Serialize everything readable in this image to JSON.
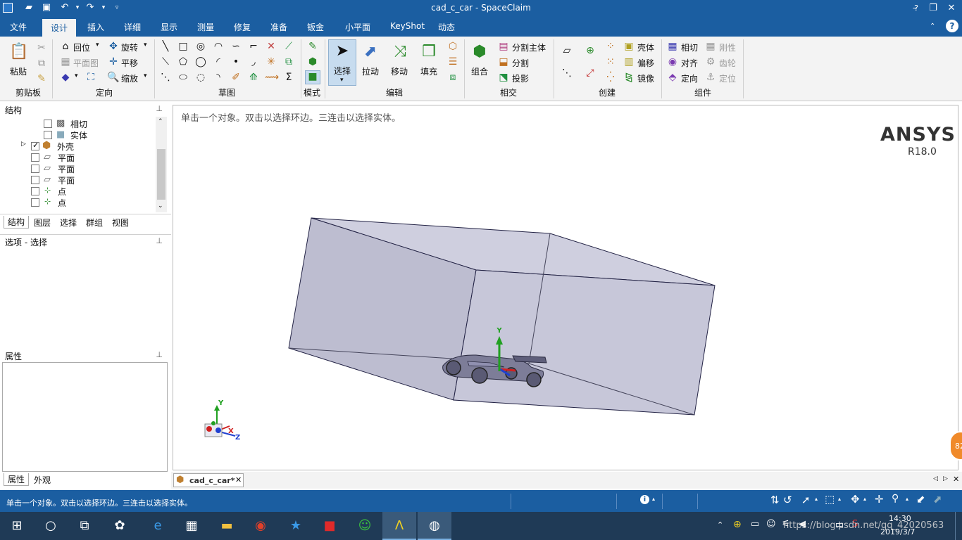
{
  "window": {
    "title": "cad_c_car - SpaceClaim",
    "controls": [
      "?",
      "–",
      "❐",
      "✕"
    ]
  },
  "menu": {
    "items": [
      "文件",
      "设计",
      "插入",
      "详细",
      "显示",
      "测量",
      "修复",
      "准备",
      "钣金",
      "小平面",
      "KeyShot",
      "动态"
    ],
    "active_index": 1
  },
  "ribbon": {
    "clipboard": {
      "paste": "粘贴",
      "group": "剪贴板"
    },
    "orient": {
      "home": "回位",
      "rotate": "旋转",
      "plan": "平面图",
      "pan": "平移",
      "zoom": "缩放",
      "group": "定向"
    },
    "sketch": {
      "group": "草图"
    },
    "mode": {
      "group": "模式"
    },
    "edit": {
      "select": "选择",
      "pull": "拉动",
      "move": "移动",
      "fill": "填充",
      "group": "编辑"
    },
    "intersect": {
      "combine": "组合",
      "split_body": "分割主体",
      "split": "分割",
      "project": "投影",
      "group": "相交"
    },
    "create": {
      "shell": "壳体",
      "offset": "偏移",
      "mirror": "镜像",
      "group": "创建"
    },
    "assembly": {
      "tangent": "相切",
      "align": "对齐",
      "orient": "定向",
      "rigid": "刚性",
      "gear": "齿轮",
      "anchor": "定位",
      "group": "组件"
    }
  },
  "structure": {
    "title": "结构",
    "items": [
      {
        "label": "相切",
        "checked": false,
        "icon": "tangent-icon"
      },
      {
        "label": "实体",
        "checked": false,
        "icon": "solid-icon"
      },
      {
        "label": "外壳",
        "checked": true,
        "icon": "shell-body-icon"
      },
      {
        "label": "平面",
        "checked": false,
        "icon": "plane-icon"
      },
      {
        "label": "平面",
        "checked": false,
        "icon": "plane-icon"
      },
      {
        "label": "平面",
        "checked": false,
        "icon": "plane-icon"
      },
      {
        "label": "点",
        "checked": false,
        "icon": "point-icon"
      },
      {
        "label": "点",
        "checked": false,
        "icon": "point-icon"
      }
    ],
    "tabs": [
      "结构",
      "图层",
      "选择",
      "群组",
      "视图"
    ]
  },
  "options": {
    "title": "选项 - 选择"
  },
  "properties": {
    "title": "属性",
    "tabs": [
      "属性",
      "外观"
    ]
  },
  "viewport": {
    "hint": "单击一个对象。双击以选择环边。三连击以选择实体。",
    "brand": "ANSYS",
    "version": "R18.0",
    "axis_y": "Y",
    "axis_x": "X",
    "axis_z": "Z"
  },
  "doc_tab": {
    "label": "cad_c_car*"
  },
  "status": {
    "text": "单击一个对象。双击以选择环边。三连击以选择实体。"
  },
  "taskbar": {
    "time": "14:30",
    "date": "2019/3/7",
    "ime": "中",
    "watermark": "https://blog.csdn.net/qq_42020563",
    "badge": "82"
  },
  "colors": {
    "accent": "#1b5ea1",
    "box_fill": "#c4c4d6",
    "box_edge": "#222244"
  }
}
